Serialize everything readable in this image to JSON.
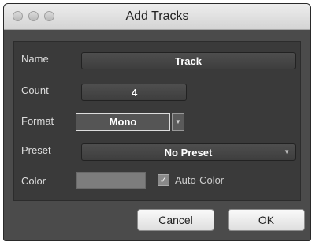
{
  "window": {
    "title": "Add Tracks"
  },
  "form": {
    "name_label": "Name",
    "name_value": "Track",
    "count_label": "Count",
    "count_value": "4",
    "format_label": "Format",
    "format_value": "Mono",
    "preset_label": "Preset",
    "preset_value": "No Preset",
    "color_label": "Color",
    "auto_color_label": "Auto-Color",
    "auto_color_checked": true,
    "swatch_color": "#7d7d7d"
  },
  "buttons": {
    "cancel": "Cancel",
    "ok": "OK"
  }
}
